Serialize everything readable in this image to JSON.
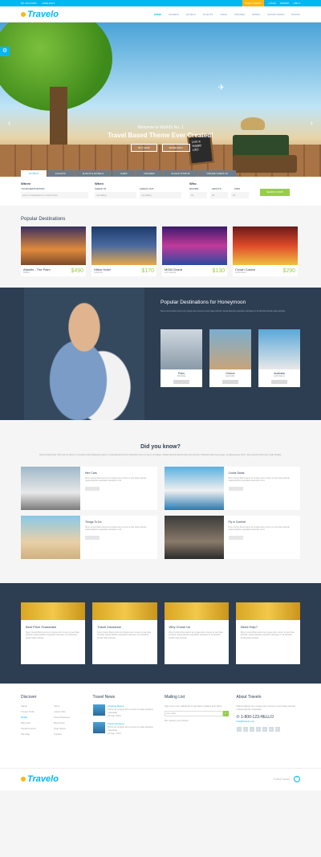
{
  "topbar": {
    "links": [
      "MY ACCOUNT",
      "ENGLISH ▾"
    ],
    "cta": "PLAN A BOOK",
    "right": [
      "LOGIN",
      "SIGNUP",
      "USD ▾"
    ]
  },
  "header": {
    "logo": "Travelo",
    "nav": [
      "HOME",
      "SLIDERS",
      "HOTELS",
      "FLIGHTS",
      "CARS",
      "CRUISES",
      "PAGES",
      "SHORTCODES",
      "BONUS"
    ]
  },
  "hero": {
    "line1": "Welcome to World's No. 1",
    "line2": "Travel Based Theme Ever Created!",
    "btn1": "BUY NOW",
    "btn2": "MORE INFO",
    "sign": "Live a Happy Life!",
    "tabs": [
      "HOTELS",
      "FLIGHTS",
      "FLIGHT & HOTELS",
      "CARS",
      "CRUISES",
      "FLIGHT STATUS",
      "ONLINE CHECK IN"
    ]
  },
  "search": {
    "where": "Where",
    "where_label": "YOUR DESTINATION",
    "where_ph": "enter a destination or hotel name",
    "when": "When",
    "checkin": "CHECK IN",
    "checkout": "CHECK OUT",
    "date_ph": "mm/dd/yy",
    "who": "Who",
    "rooms": "ROOMS",
    "adults": "ADULTS",
    "kids": "KIDS",
    "num": "01",
    "btn": "SEARCH NOW"
  },
  "popular": {
    "title": "Popular Destinations",
    "items": [
      {
        "name": "Atlantis - The Palm",
        "sub": "DUBAI",
        "price": "$490"
      },
      {
        "name": "Hilton Hotel",
        "sub": "LONDON",
        "price": "$170"
      },
      {
        "name": "MGM Grand",
        "sub": "LAS VEGAS",
        "price": "$130"
      },
      {
        "name": "Crown Casino",
        "sub": "AUSTRALIA",
        "price": "$290"
      }
    ]
  },
  "honey": {
    "title": "Popular Destinations for Honeymoon",
    "text": "Nunc cursus libero purus ac congue arcu cursus ut sed vitae pulvinar massa idporta nequetiam elerisque mi id faucibus iaculis vitae pulvinar.",
    "items": [
      {
        "name": "Paris",
        "sub": "FRANCE"
      },
      {
        "name": "Greece",
        "sub": "EUROPE"
      },
      {
        "name": "Australia",
        "sub": "AUSTRALIA"
      }
    ]
  },
  "dyk": {
    "title": "Did you know?",
    "text": "Mauris ullamcorper nibh quis leo ultrices in hendrerit velit tristiquesut augue in nulla lacinia bibendum liberoras rutrum ac purus ut tristique. Nullam placerat lacinia dolor quis pulvinar. Phasellus vitae turpis quam, at pellentesque lorem. Sed euismod turpis quis mattis fringilla.",
    "items": [
      {
        "title": "Hire Cars",
        "text": "Nunc cursus libero purus ac congue arcu cursus ut sed vitae pulvinar massa idporta nequetiam elerisque mi id."
      },
      {
        "title": "Cruise Deals",
        "text": "Nunc cursus libero purus ac congue arcu cursus ut sed vitae pulvinar massa idporta nequetiam elerisque mi id."
      },
      {
        "title": "Things To Do",
        "text": "Nunc cursus libero purus ac congue arcu cursus ut sed vitae pulvinar massa idporta nequetiam elerisque mi id."
      },
      {
        "title": "Fly in Comfort",
        "text": "Nunc cursus libero purus ac congue arcu cursus ut sed vitae pulvinar massa idporta nequetiam elerisque mi id."
      }
    ]
  },
  "why": [
    {
      "title": "Best Price Guarantee",
      "text": "Nunc cursus libero purus ac congue arcu cursus ut sed vitae pulvinar massa idporta nequetiam elerisque mi id faucibus iaculis vitae pulvinar."
    },
    {
      "title": "Travel Insurance",
      "text": "Nunc cursus libero purus ac congue arcu cursus ut sed vitae pulvinar massa idporta nequetiam elerisque mi id faucibus iaculis vitae pulvinar."
    },
    {
      "title": "Why Chose Us",
      "text": "Nunc cursus libero purus ac congue arcu cursus ut sed vitae pulvinar massa idporta nequetiam elerisque mi id faucibus iaculis vitae pulvinar."
    },
    {
      "title": "Need Help?",
      "text": "Nunc cursus libero purus ac congue arcu cursus ut sed vitae pulvinar massa idporta nequetiam elerisque mi id faucibus iaculis vitae pulvinar."
    }
  ],
  "footer": {
    "discover": {
      "title": "Discover",
      "links": [
        "Safety",
        "About",
        "Travelo Picks",
        "Latest Jobs",
        "Mobile",
        "Press Releases",
        "Why Host",
        "Blog Posts",
        "Social Connect",
        "Help Topics",
        "Site Map",
        "Policies"
      ]
    },
    "news": {
      "title": "Travel News",
      "items": [
        {
          "title": "Amazing Places",
          "text": "Purus ac congue arcu cursus ut vitae pulvinar massaidp.",
          "date": "25 Sep, 2013"
        },
        {
          "title": "Travel Insurance",
          "text": "Purus ac congue arcu cursus ut vitae pulvinar massaidp.",
          "date": "24 Sep, 2013"
        }
      ]
    },
    "mail": {
      "title": "Mailing List",
      "text": "Sign up for our mailing list to get latest updates and offers.",
      "ph": "your email",
      "note": "We respect your privacy"
    },
    "about": {
      "title": "About Travelo",
      "text": "Mauris aliquet nec congue arcu cursus ut sed vitae pulvinar massa idporta nequetiam.",
      "phone": "1-800-123-HELLO",
      "email": "help@travelo.com"
    }
  },
  "bottom": {
    "logo": "Travelo",
    "copy": "© 2014 Travelo"
  }
}
